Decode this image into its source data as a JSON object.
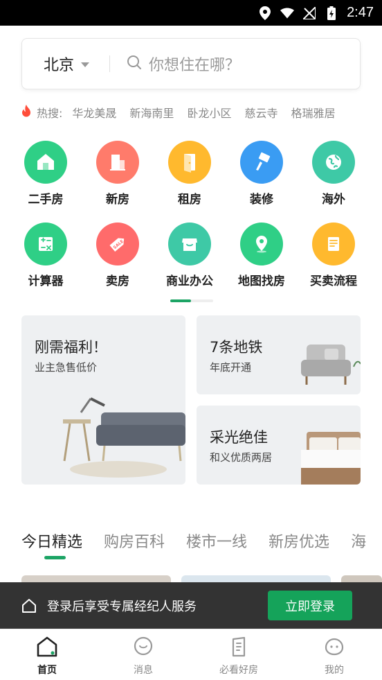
{
  "status_bar": {
    "time": "2:47"
  },
  "search": {
    "city": "北京",
    "placeholder": "你想住在哪？"
  },
  "hot_search": {
    "label": "热搜:",
    "keywords": [
      "华龙美晟",
      "新海南里",
      "卧龙小区",
      "慈云寺",
      "格瑞雅居"
    ]
  },
  "grid": [
    {
      "label": "二手房",
      "icon": "house-icon",
      "color": "#2fcf86"
    },
    {
      "label": "新房",
      "icon": "building-icon",
      "color": "#ff7b6b"
    },
    {
      "label": "租房",
      "icon": "door-icon",
      "color": "#ffb92e"
    },
    {
      "label": "装修",
      "icon": "paintbrush-icon",
      "color": "#3a9cf3"
    },
    {
      "label": "海外",
      "icon": "globe-icon",
      "color": "#3ec9a6"
    },
    {
      "label": "计算器",
      "icon": "calculator-icon",
      "color": "#2fcf86"
    },
    {
      "label": "卖房",
      "icon": "sale-tag-icon",
      "color": "#ff6b6b"
    },
    {
      "label": "商业办公",
      "icon": "shop-icon",
      "color": "#3ec9a6"
    },
    {
      "label": "地图找房",
      "icon": "map-pin-icon",
      "color": "#2fcf86"
    },
    {
      "label": "买卖流程",
      "icon": "document-icon",
      "color": "#ffb92e"
    }
  ],
  "banners": {
    "big": {
      "title": "刚需福利！",
      "subtitle": "业主急售低价"
    },
    "top_right": {
      "title": "7条地铁",
      "subtitle": "年底开通"
    },
    "bottom_right": {
      "title": "采光绝佳",
      "subtitle": "和义优质两居"
    }
  },
  "tabs": [
    "今日精选",
    "购房百科",
    "楼市一线",
    "新房优选",
    "海"
  ],
  "login_bar": {
    "text": "登录后享受专属经纪人服务",
    "button": "立即登录"
  },
  "bottom_nav": [
    {
      "label": "首页",
      "icon": "home-icon",
      "active": true
    },
    {
      "label": "消息",
      "icon": "message-icon",
      "active": false
    },
    {
      "label": "必看好房",
      "icon": "good-house-icon",
      "active": false
    },
    {
      "label": "我的",
      "icon": "profile-icon",
      "active": false
    }
  ],
  "colors": {
    "accent": "#1ca465",
    "login_bar": "#333333",
    "login_button": "#15a35a"
  }
}
